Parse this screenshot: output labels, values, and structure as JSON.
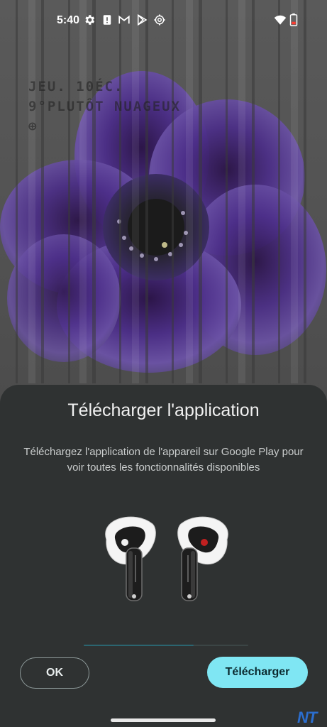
{
  "status_bar": {
    "time": "5:40",
    "left_icons": [
      "settings-gear-icon",
      "alert-icon",
      "gmail-icon",
      "play-store-icon",
      "settings-outline-icon"
    ],
    "right_icons": [
      "wifi-icon",
      "battery-low-icon"
    ]
  },
  "wallpaper": {
    "clock_lines": [
      "JEU. 10ÉC.",
      "9°PLUTÔT NUAGEUX",
      "⊕"
    ],
    "description": "purple anemone flower with vertical glass-ripple effect"
  },
  "dialog": {
    "title": "Télécharger l'application",
    "description": "Téléchargez l'application de l'appareil sur Google Play pour voir toutes les fonctionnalités disponibles",
    "image_icon": "nothing-ear-earbuds-image",
    "progress": 0.67,
    "ok_label": "OK",
    "download_label": "Télécharger"
  },
  "watermark": "NT",
  "colors": {
    "sheet_bg": "#2f3232",
    "accent": "#7fe6f3",
    "progress": "#2b6570"
  }
}
